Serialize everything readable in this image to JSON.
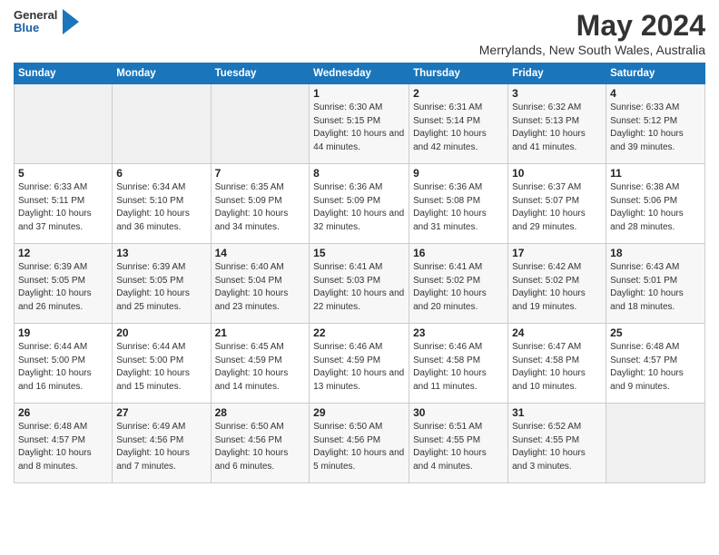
{
  "logo": {
    "general": "General",
    "blue": "Blue"
  },
  "title": "May 2024",
  "subtitle": "Merrylands, New South Wales, Australia",
  "days_header": [
    "Sunday",
    "Monday",
    "Tuesday",
    "Wednesday",
    "Thursday",
    "Friday",
    "Saturday"
  ],
  "weeks": [
    [
      {
        "day": "",
        "sunrise": "",
        "sunset": "",
        "daylight": ""
      },
      {
        "day": "",
        "sunrise": "",
        "sunset": "",
        "daylight": ""
      },
      {
        "day": "",
        "sunrise": "",
        "sunset": "",
        "daylight": ""
      },
      {
        "day": "1",
        "sunrise": "Sunrise: 6:30 AM",
        "sunset": "Sunset: 5:15 PM",
        "daylight": "Daylight: 10 hours and 44 minutes."
      },
      {
        "day": "2",
        "sunrise": "Sunrise: 6:31 AM",
        "sunset": "Sunset: 5:14 PM",
        "daylight": "Daylight: 10 hours and 42 minutes."
      },
      {
        "day": "3",
        "sunrise": "Sunrise: 6:32 AM",
        "sunset": "Sunset: 5:13 PM",
        "daylight": "Daylight: 10 hours and 41 minutes."
      },
      {
        "day": "4",
        "sunrise": "Sunrise: 6:33 AM",
        "sunset": "Sunset: 5:12 PM",
        "daylight": "Daylight: 10 hours and 39 minutes."
      }
    ],
    [
      {
        "day": "5",
        "sunrise": "Sunrise: 6:33 AM",
        "sunset": "Sunset: 5:11 PM",
        "daylight": "Daylight: 10 hours and 37 minutes."
      },
      {
        "day": "6",
        "sunrise": "Sunrise: 6:34 AM",
        "sunset": "Sunset: 5:10 PM",
        "daylight": "Daylight: 10 hours and 36 minutes."
      },
      {
        "day": "7",
        "sunrise": "Sunrise: 6:35 AM",
        "sunset": "Sunset: 5:09 PM",
        "daylight": "Daylight: 10 hours and 34 minutes."
      },
      {
        "day": "8",
        "sunrise": "Sunrise: 6:36 AM",
        "sunset": "Sunset: 5:09 PM",
        "daylight": "Daylight: 10 hours and 32 minutes."
      },
      {
        "day": "9",
        "sunrise": "Sunrise: 6:36 AM",
        "sunset": "Sunset: 5:08 PM",
        "daylight": "Daylight: 10 hours and 31 minutes."
      },
      {
        "day": "10",
        "sunrise": "Sunrise: 6:37 AM",
        "sunset": "Sunset: 5:07 PM",
        "daylight": "Daylight: 10 hours and 29 minutes."
      },
      {
        "day": "11",
        "sunrise": "Sunrise: 6:38 AM",
        "sunset": "Sunset: 5:06 PM",
        "daylight": "Daylight: 10 hours and 28 minutes."
      }
    ],
    [
      {
        "day": "12",
        "sunrise": "Sunrise: 6:39 AM",
        "sunset": "Sunset: 5:05 PM",
        "daylight": "Daylight: 10 hours and 26 minutes."
      },
      {
        "day": "13",
        "sunrise": "Sunrise: 6:39 AM",
        "sunset": "Sunset: 5:05 PM",
        "daylight": "Daylight: 10 hours and 25 minutes."
      },
      {
        "day": "14",
        "sunrise": "Sunrise: 6:40 AM",
        "sunset": "Sunset: 5:04 PM",
        "daylight": "Daylight: 10 hours and 23 minutes."
      },
      {
        "day": "15",
        "sunrise": "Sunrise: 6:41 AM",
        "sunset": "Sunset: 5:03 PM",
        "daylight": "Daylight: 10 hours and 22 minutes."
      },
      {
        "day": "16",
        "sunrise": "Sunrise: 6:41 AM",
        "sunset": "Sunset: 5:02 PM",
        "daylight": "Daylight: 10 hours and 20 minutes."
      },
      {
        "day": "17",
        "sunrise": "Sunrise: 6:42 AM",
        "sunset": "Sunset: 5:02 PM",
        "daylight": "Daylight: 10 hours and 19 minutes."
      },
      {
        "day": "18",
        "sunrise": "Sunrise: 6:43 AM",
        "sunset": "Sunset: 5:01 PM",
        "daylight": "Daylight: 10 hours and 18 minutes."
      }
    ],
    [
      {
        "day": "19",
        "sunrise": "Sunrise: 6:44 AM",
        "sunset": "Sunset: 5:00 PM",
        "daylight": "Daylight: 10 hours and 16 minutes."
      },
      {
        "day": "20",
        "sunrise": "Sunrise: 6:44 AM",
        "sunset": "Sunset: 5:00 PM",
        "daylight": "Daylight: 10 hours and 15 minutes."
      },
      {
        "day": "21",
        "sunrise": "Sunrise: 6:45 AM",
        "sunset": "Sunset: 4:59 PM",
        "daylight": "Daylight: 10 hours and 14 minutes."
      },
      {
        "day": "22",
        "sunrise": "Sunrise: 6:46 AM",
        "sunset": "Sunset: 4:59 PM",
        "daylight": "Daylight: 10 hours and 13 minutes."
      },
      {
        "day": "23",
        "sunrise": "Sunrise: 6:46 AM",
        "sunset": "Sunset: 4:58 PM",
        "daylight": "Daylight: 10 hours and 11 minutes."
      },
      {
        "day": "24",
        "sunrise": "Sunrise: 6:47 AM",
        "sunset": "Sunset: 4:58 PM",
        "daylight": "Daylight: 10 hours and 10 minutes."
      },
      {
        "day": "25",
        "sunrise": "Sunrise: 6:48 AM",
        "sunset": "Sunset: 4:57 PM",
        "daylight": "Daylight: 10 hours and 9 minutes."
      }
    ],
    [
      {
        "day": "26",
        "sunrise": "Sunrise: 6:48 AM",
        "sunset": "Sunset: 4:57 PM",
        "daylight": "Daylight: 10 hours and 8 minutes."
      },
      {
        "day": "27",
        "sunrise": "Sunrise: 6:49 AM",
        "sunset": "Sunset: 4:56 PM",
        "daylight": "Daylight: 10 hours and 7 minutes."
      },
      {
        "day": "28",
        "sunrise": "Sunrise: 6:50 AM",
        "sunset": "Sunset: 4:56 PM",
        "daylight": "Daylight: 10 hours and 6 minutes."
      },
      {
        "day": "29",
        "sunrise": "Sunrise: 6:50 AM",
        "sunset": "Sunset: 4:56 PM",
        "daylight": "Daylight: 10 hours and 5 minutes."
      },
      {
        "day": "30",
        "sunrise": "Sunrise: 6:51 AM",
        "sunset": "Sunset: 4:55 PM",
        "daylight": "Daylight: 10 hours and 4 minutes."
      },
      {
        "day": "31",
        "sunrise": "Sunrise: 6:52 AM",
        "sunset": "Sunset: 4:55 PM",
        "daylight": "Daylight: 10 hours and 3 minutes."
      },
      {
        "day": "",
        "sunrise": "",
        "sunset": "",
        "daylight": ""
      }
    ]
  ]
}
